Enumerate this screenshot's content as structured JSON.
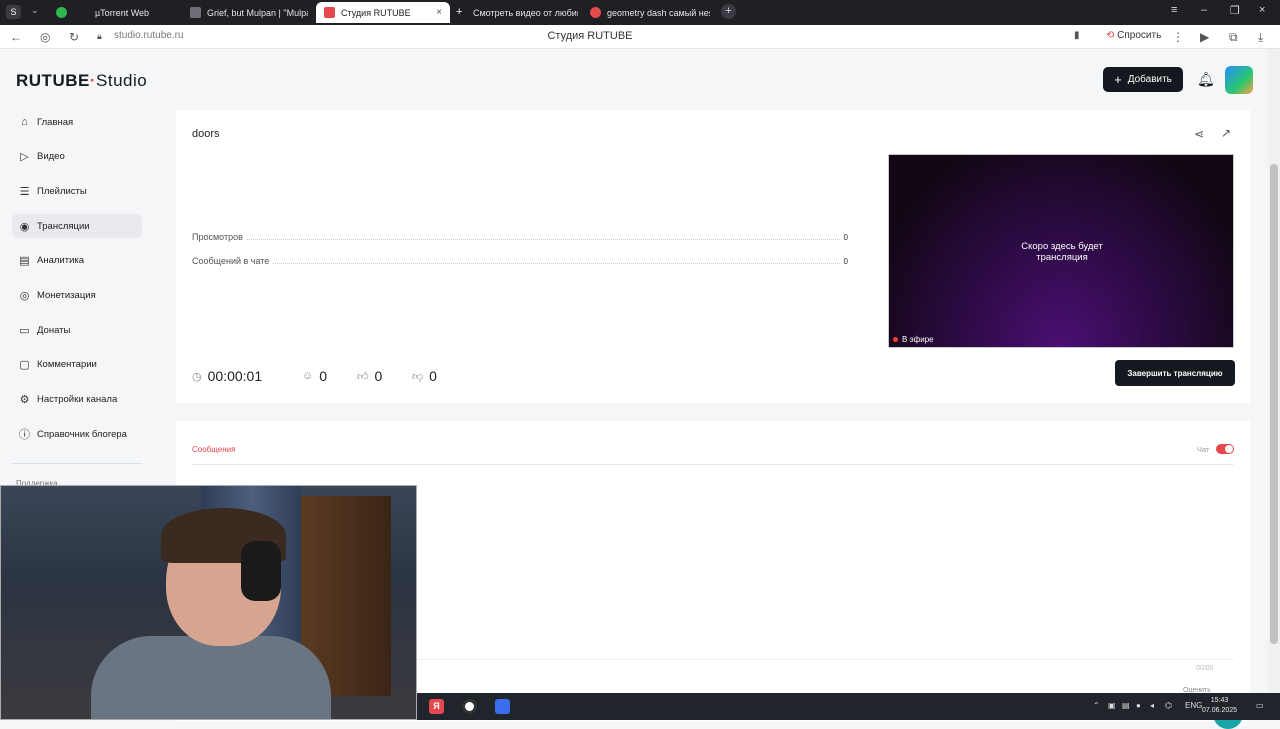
{
  "browser": {
    "tabs": [
      {
        "label": "µTorrent Web",
        "color": "#2db84d"
      },
      {
        "label": "Grief, but Mulpan | \"Mulpa",
        "color": "#6f6f7a"
      },
      {
        "label": "Студия RUTUBE",
        "color": "#e5484d"
      },
      {
        "label": "Смотреть видео от любим",
        "color": "#ff4a3d"
      },
      {
        "label": "geometry dash самый нея",
        "color": "#e5484d"
      }
    ],
    "url": "studio.rutube.ru",
    "page_title": "Студия RUTUBE",
    "ask_label": "Спросить"
  },
  "header": {
    "logo_main": "RUTUBE",
    "logo_dot": "·",
    "logo_studio": "Studio",
    "add_label": "Добавить"
  },
  "sidebar": {
    "items": [
      {
        "label": "Главная",
        "icon": "home-icon",
        "glyph": "⌂"
      },
      {
        "label": "Видео",
        "icon": "video-icon",
        "glyph": "▷"
      },
      {
        "label": "Плейлисты",
        "icon": "playlist-icon",
        "glyph": "☰"
      },
      {
        "label": "Трансляции",
        "icon": "broadcast-icon",
        "glyph": "◉"
      },
      {
        "label": "Аналитика",
        "icon": "analytics-icon",
        "glyph": "▤"
      },
      {
        "label": "Монетизация",
        "icon": "money-icon",
        "glyph": "◎"
      },
      {
        "label": "Донаты",
        "icon": "donate-icon",
        "glyph": "▭"
      },
      {
        "label": "Комментарии",
        "icon": "comments-icon",
        "glyph": "▢"
      },
      {
        "label": "Настройки канала",
        "icon": "settings-icon",
        "glyph": "⚙"
      },
      {
        "label": "Справочник блогера",
        "icon": "info-icon",
        "glyph": "ⓘ"
      }
    ],
    "active_index": 3,
    "support_label": "Поддержка"
  },
  "stream": {
    "title": "doors",
    "stats": [
      {
        "label": "Просмотров",
        "value": "0"
      },
      {
        "label": "Сообщений в чате",
        "value": "0"
      }
    ],
    "preview_text_1": "Скоро здесь будет",
    "preview_text_2": "трансляция",
    "live_label": "В эфире",
    "duration": "00:00:01",
    "viewers": "0",
    "likes": "0",
    "dislikes": "0",
    "end_button": "Завершить трансляцию"
  },
  "messages": {
    "tab_label": "Сообщения",
    "chat_label": "Чат",
    "chat_enabled": true,
    "counter": "0/200",
    "rate_label": "Оценить"
  },
  "taskbar": {
    "lang": "ENG",
    "time": "15:43",
    "date": "07.06.2025"
  },
  "colors": {
    "accent_red": "#e5484d",
    "dark_button": "#14191f",
    "support_fab": "#1aa6a6"
  }
}
